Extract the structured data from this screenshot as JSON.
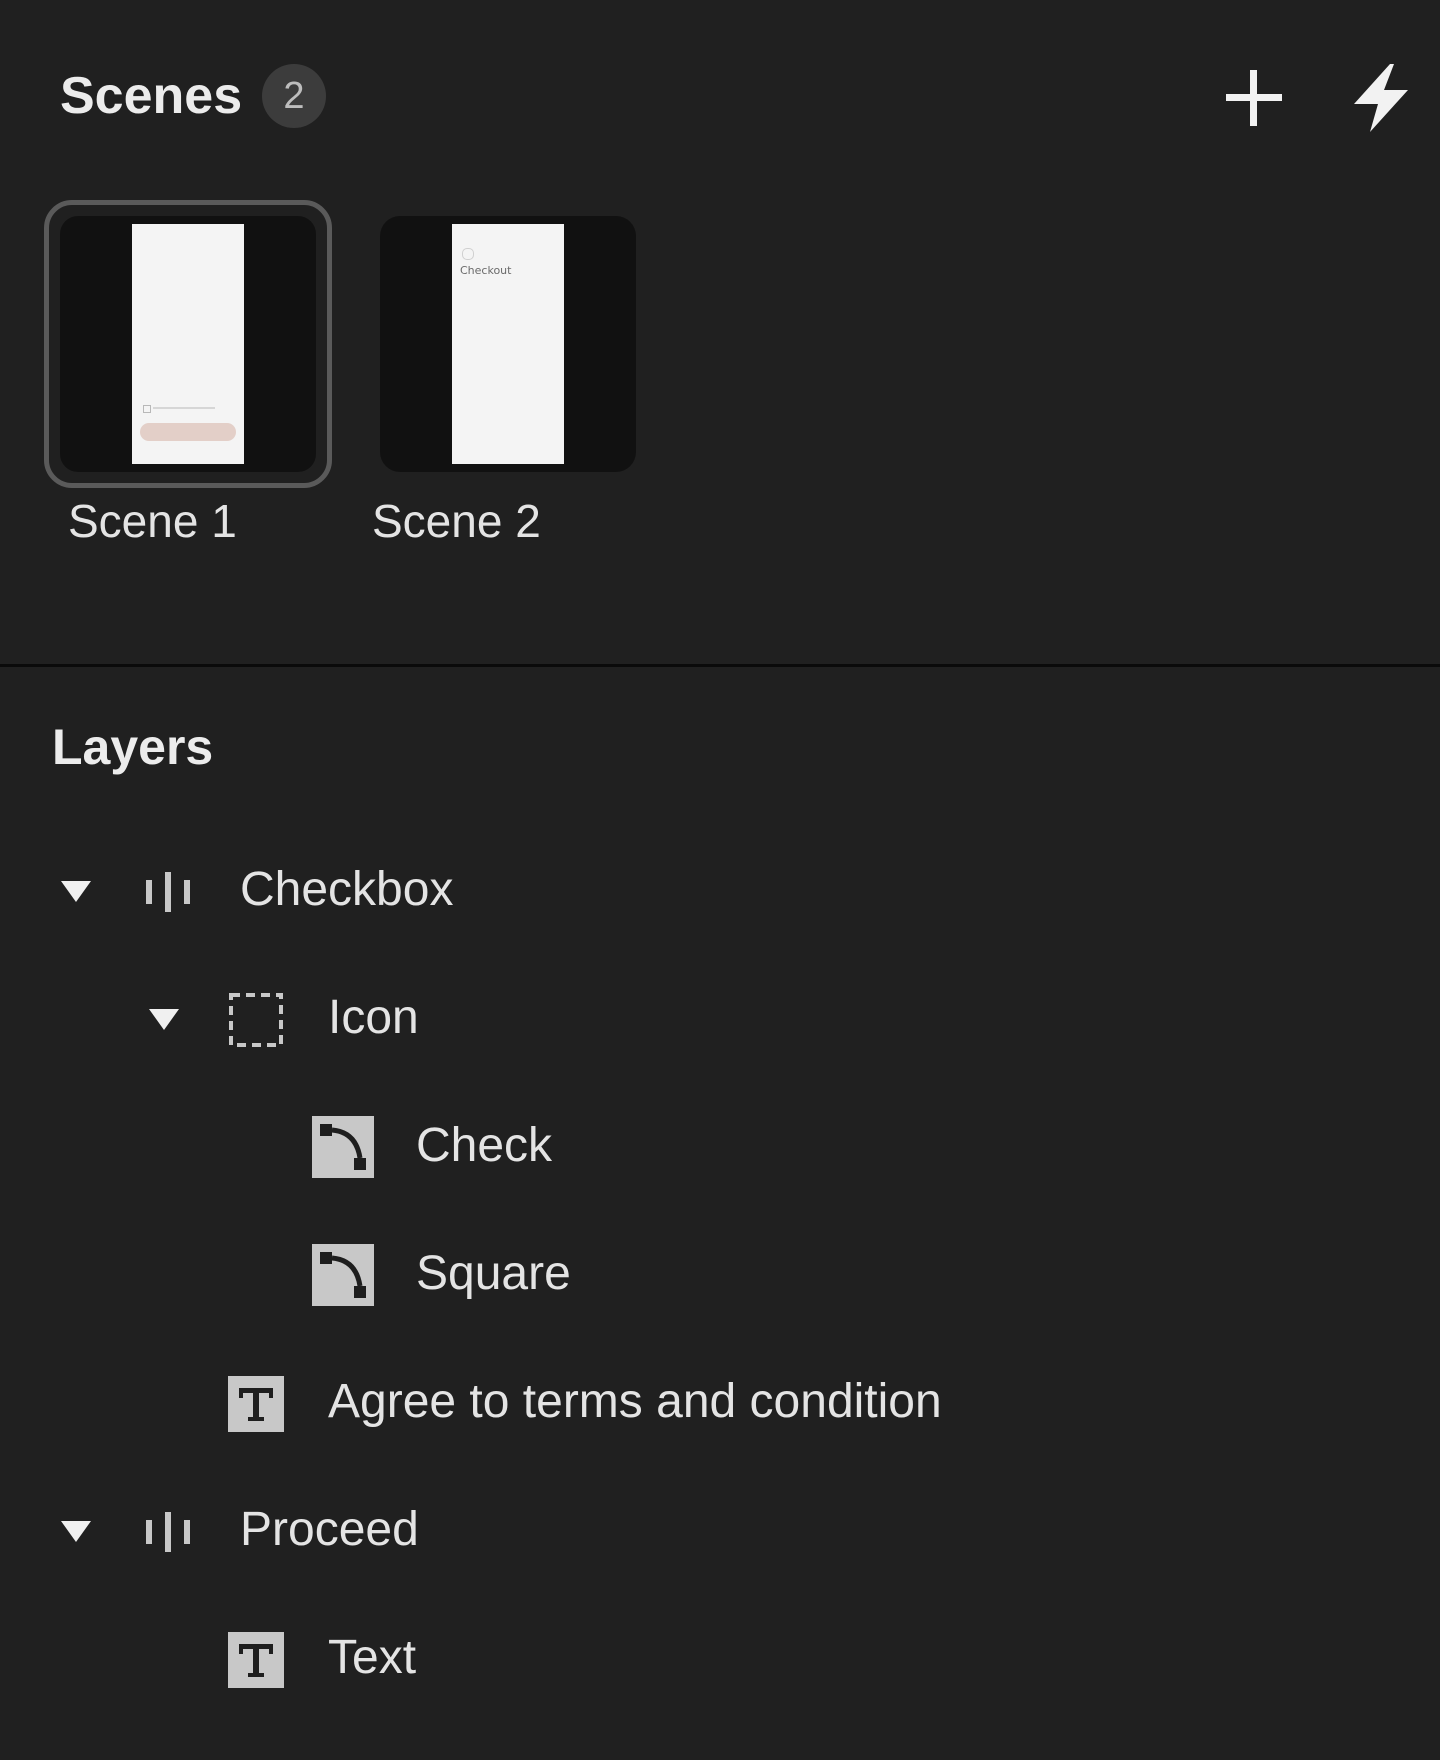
{
  "scenes": {
    "title": "Scenes",
    "count": "2",
    "add_icon": "plus-icon",
    "bolt_icon": "lightning-bolt-icon",
    "items": [
      {
        "label": "Scene 1",
        "selected": true
      },
      {
        "label": "Scene 2",
        "selected": false,
        "preview_title": "Checkout"
      }
    ]
  },
  "layers": {
    "title": "Layers",
    "items": [
      {
        "label": "Checkbox",
        "type": "stack-icon",
        "expanded": true
      },
      {
        "label": "Icon",
        "type": "frame-icon",
        "expanded": true
      },
      {
        "label": "Check",
        "type": "path-icon"
      },
      {
        "label": "Square",
        "type": "path-icon"
      },
      {
        "label": "Agree to terms and condition",
        "type": "text-icon"
      },
      {
        "label": "Proceed",
        "type": "stack-icon",
        "expanded": true
      },
      {
        "label": "Text",
        "type": "text-icon"
      }
    ]
  },
  "colors": {
    "background": "#202020",
    "text": "#e4e4e4",
    "badge": "#3c3c3c",
    "selected_border": "#5a5a5a",
    "icon_fill": "#c8c8c8"
  }
}
